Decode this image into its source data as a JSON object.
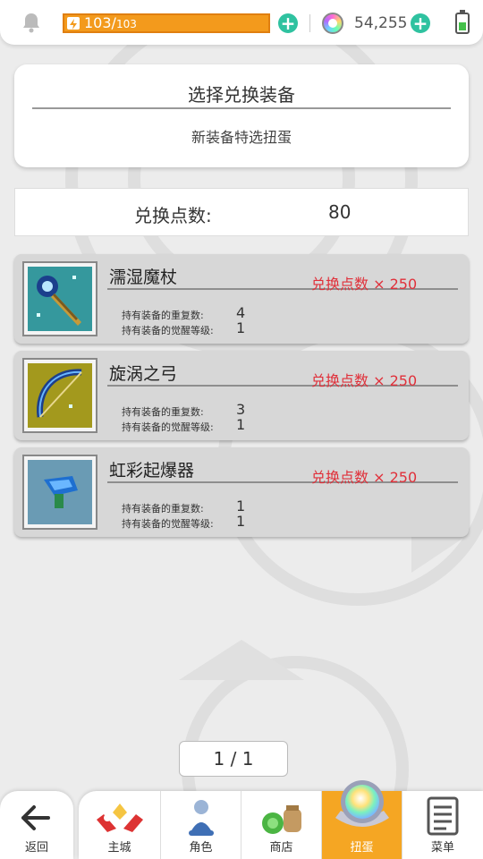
{
  "status": {
    "energy_current": "103/",
    "energy_max": "103",
    "gems": "54,255",
    "plus_symbol": "+",
    "accent_color": "#2fc2a0",
    "energy_color": "#f39a1c"
  },
  "header": {
    "title": "选择兑换装备",
    "subtitle": "新装备特选扭蛋"
  },
  "points": {
    "label": "兑换点数:",
    "value": "80"
  },
  "items": [
    {
      "name": "濡湿魔杖",
      "cost": "兑换点数 × 250",
      "dup_label": "持有装备的重复数:",
      "dup_value": "4",
      "awaken_label": "持有装备的觉醒等级:",
      "awaken_value": "1",
      "icon": "staff-icon"
    },
    {
      "name": "旋涡之弓",
      "cost": "兑换点数 × 250",
      "dup_label": "持有装备的重复数:",
      "dup_value": "3",
      "awaken_label": "持有装备的觉醒等级:",
      "awaken_value": "1",
      "icon": "bow-icon"
    },
    {
      "name": "虹彩起爆器",
      "cost": "兑换点数 × 250",
      "dup_label": "持有装备的重复数:",
      "dup_value": "1",
      "awaken_label": "持有装备的觉醒等级:",
      "awaken_value": "1",
      "icon": "detonator-icon"
    }
  ],
  "pager": {
    "text": "1 / 1"
  },
  "nav": {
    "back": "返回",
    "tabs": [
      "主城",
      "角色",
      "商店",
      "扭蛋",
      "菜单"
    ]
  }
}
